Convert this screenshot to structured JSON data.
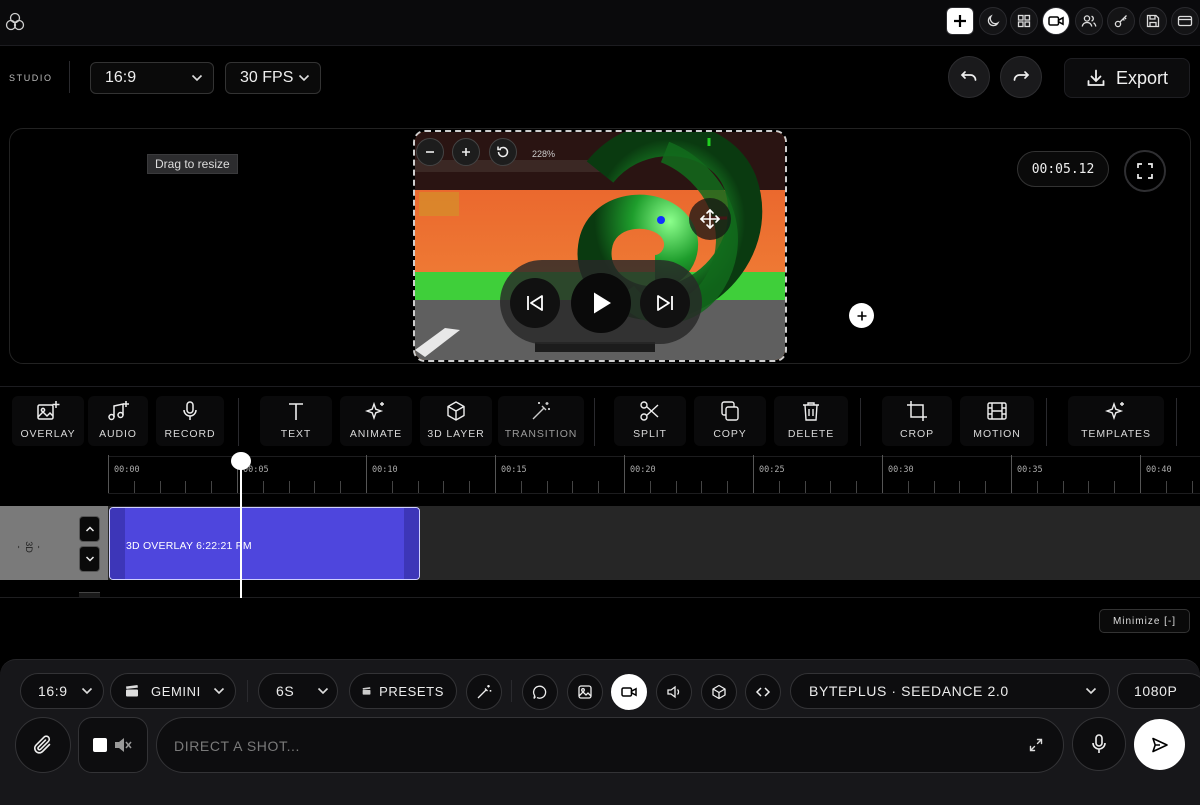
{
  "studio": {
    "label": "STUDIO",
    "aspect_ratio": "16:9",
    "fps": "30 FPS",
    "export_label": "Export"
  },
  "preview": {
    "tooltip": "Drag to resize",
    "zoom_level": "228%",
    "timecode": "00:05.12"
  },
  "toolbar": {
    "tools": [
      {
        "label": "OVERLAY",
        "icon": "image-plus-icon"
      },
      {
        "label": "AUDIO",
        "icon": "music-plus-icon"
      },
      {
        "label": "RECORD",
        "icon": "microphone-icon"
      },
      {
        "label": "TEXT",
        "icon": "text-icon"
      },
      {
        "label": "ANIMATE",
        "icon": "sparkles-icon"
      },
      {
        "label": "3D LAYER",
        "icon": "cube-icon"
      },
      {
        "label": "TRANSITION",
        "icon": "magic-wand-icon"
      },
      {
        "label": "SPLIT",
        "icon": "scissors-icon"
      },
      {
        "label": "COPY",
        "icon": "copy-icon"
      },
      {
        "label": "DELETE",
        "icon": "trash-icon"
      },
      {
        "label": "CROP",
        "icon": "crop-icon"
      },
      {
        "label": "MOTION",
        "icon": "film-icon"
      },
      {
        "label": "TEMPLATES",
        "icon": "sparkles-icon"
      }
    ]
  },
  "timeline": {
    "ruler": [
      "00:00",
      "00:05",
      "00:10",
      "00:15",
      "00:20",
      "00:25",
      "00:30",
      "00:35",
      "00:40"
    ],
    "track_label": "- 3D -",
    "clip_label": "3D OVERLAY 6:22:21 PM",
    "minimize_label": "Minimize [-]"
  },
  "prompt": {
    "aspect_ratio": "16:9",
    "model_provider": "GEMINI",
    "duration": "6S",
    "presets_label": "PRESETS",
    "model": "BYTEPLUS · SEEDANCE 2.0",
    "resolution": "1080P",
    "placeholder": "DIRECT A SHOT...",
    "audio_checked": false
  },
  "colors": {
    "accent_clip": "#4e46dd",
    "background": "#000000",
    "panel": "#17171a",
    "active": "#ffffff"
  }
}
